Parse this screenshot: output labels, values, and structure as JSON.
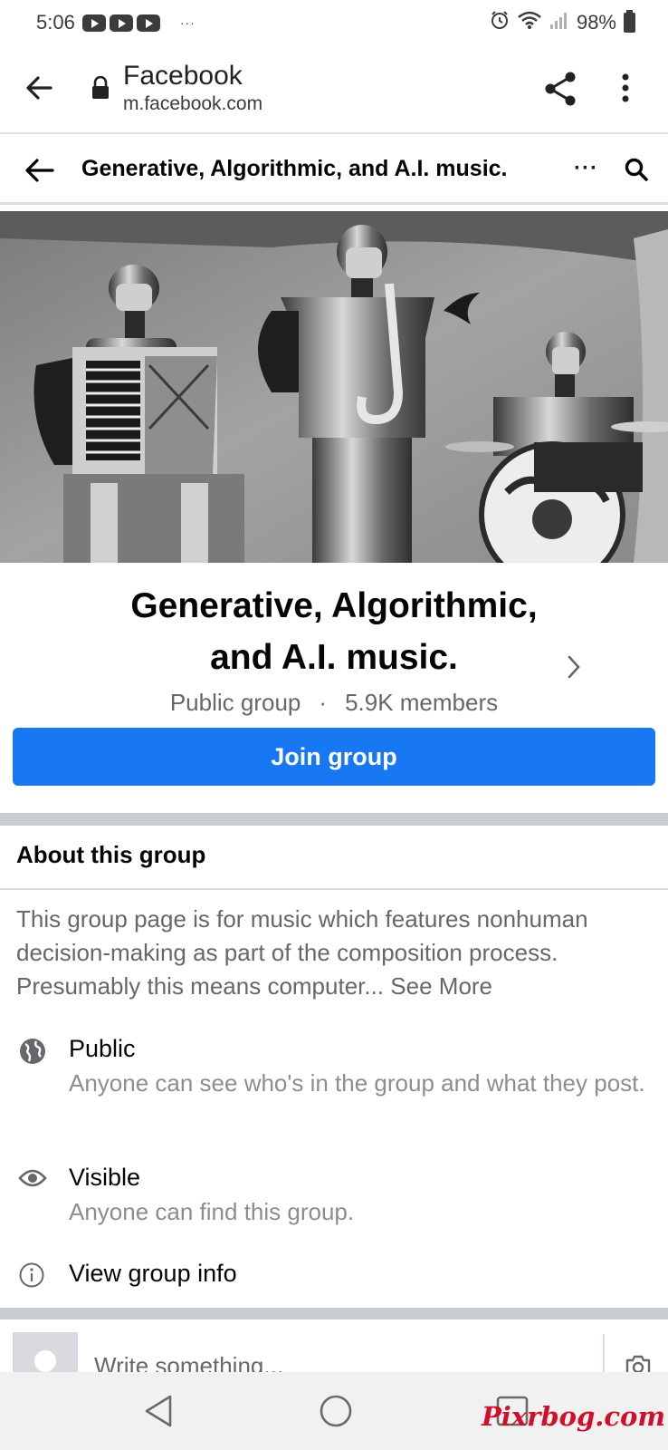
{
  "status_bar": {
    "time": "5:06",
    "notification_icons": [
      "youtube-icon",
      "youtube-icon",
      "youtube-icon"
    ],
    "overflow": "···",
    "battery": "98%"
  },
  "browser": {
    "site_title": "Facebook",
    "url": "m.facebook.com"
  },
  "group_bar": {
    "title": "Generative, Algorithmic, and A.I. music.",
    "more": "···"
  },
  "group": {
    "name": "Generative, Algorithmic, and A.I. music.",
    "privacy": "Public group",
    "separator": "·",
    "members": "5.9K members",
    "join_label": "Join group"
  },
  "about": {
    "heading": "About this group",
    "description": "This group page is for music which features nonhuman decision-making as part of the composition process.  Presumably this means computer...",
    "see_more": "See More",
    "items": [
      {
        "icon": "globe-icon",
        "title": "Public",
        "detail": "Anyone can see who's in the group and what they post."
      },
      {
        "icon": "eye-icon",
        "title": "Visible",
        "detail": "Anyone can find this group."
      },
      {
        "icon": "info-icon",
        "title": "View group info",
        "detail": ""
      }
    ]
  },
  "composer": {
    "placeholder": "Write something..."
  },
  "watermark": "Pixrbog.com"
}
